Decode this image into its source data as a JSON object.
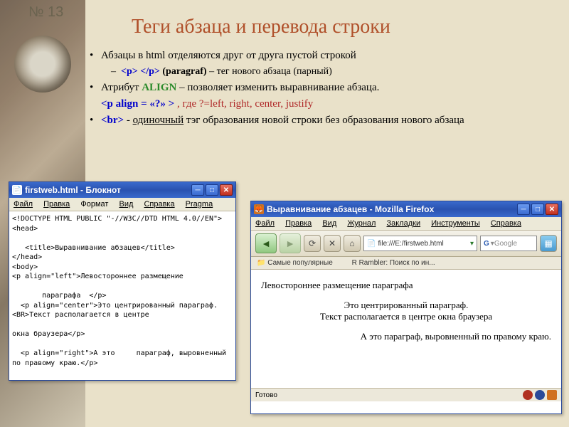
{
  "slide_number": "№ 13",
  "slide_title": "Теги абзаца и перевода строки",
  "bullet1_a": "Абзацы в html отделяются друг от друга пустой строкой",
  "sub1_tag": "<p> </p> ",
  "sub1_attr": "(paragraf)",
  "sub1_txt": "– тег нового абзаца (парный)",
  "bullet2_a": "Атрибут ",
  "bullet2_attr": "ALIGN",
  "bullet2_b": " – позволяет изменить выравнивание абзаца.",
  "line3_a": "<p  align",
  "line3_b": "= «?» >",
  "line3_c": ", где ?=left, right, center, justify",
  "bullet4_tag": "<br>",
  "bullet4_dash": " -",
  "bullet4_u": "одиночный",
  "bullet4_rest": " тэг образования новой строки без образования нового абзаца",
  "notepad": {
    "title": "firstweb.html - Блокнот",
    "menu": {
      "file": "Файл",
      "edit": "Правка",
      "format": "Формат",
      "view": "Вид",
      "help": "Справка",
      "pragma": "Pragma"
    },
    "code": "<!DOCTYPE HTML PUBLIC \"-//W3C//DTD HTML 4.0//EN\">\n<head>\n\n   <title>Выравнивание абзацев</title>\n</head>\n<body>\n<p align=\"left\">Левостороннее размещение\n\n       параграфа  </p>\n  <p align=\"center\">Это центрированный параграф.<BR>Текст располагается в центре\n\nокна браузера</p>\n\n  <p align=\"right\">А это     параграф, выровненный по правому краю.</p>\n\n</body>\n</html>"
  },
  "firefox": {
    "title": "Выравнивание абзацев - Mozilla Firefox",
    "menu": {
      "file": "Файл",
      "edit": "Правка",
      "view": "Вид",
      "history": "Журнал",
      "bookmarks": "Закладки",
      "tools": "Инструменты",
      "help": "Справка"
    },
    "url": "file:///E:/firstweb.html",
    "search_placeholder": "Google",
    "bookmarks": {
      "popular": "Самые популярные",
      "rambler": "Rambler: Поиск по ин..."
    },
    "page": {
      "left": "Левостороннее размещение параграфа",
      "center1": "Это центрированный параграф.",
      "center2": "Текст располагается в центре окна браузера",
      "right": "А это параграф, выровненный по правому краю."
    },
    "status": "Готово"
  }
}
